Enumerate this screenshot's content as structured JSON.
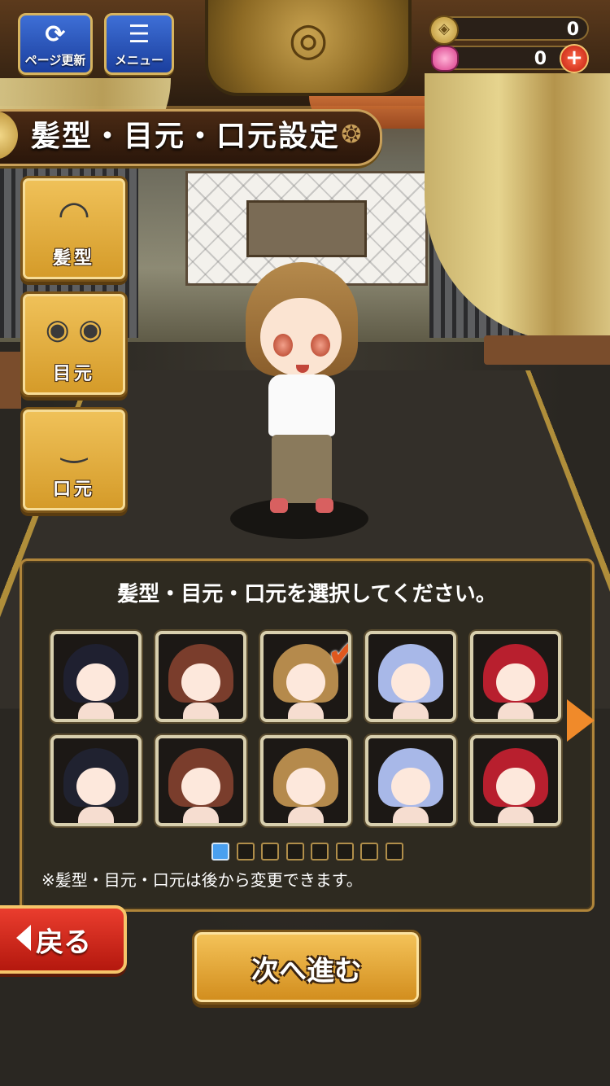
{
  "header": {
    "refresh_label": "ページ更新",
    "menu_label": "メニュー",
    "coin_count": "0",
    "gem_count": "0"
  },
  "title": "髪型・目元・口元設定",
  "categories": [
    {
      "label": "髪型",
      "icon": "hair-icon"
    },
    {
      "label": "目元",
      "icon": "eyes-icon"
    },
    {
      "label": "口元",
      "icon": "mouth-icon"
    }
  ],
  "panel": {
    "instruction": "髪型・目元・口元を選択してください。",
    "options_row1": [
      {
        "color": "#1f2030"
      },
      {
        "color": "#7a3d2c"
      },
      {
        "color": "#b58a4c",
        "selected": true
      },
      {
        "color": "#a8b8e8"
      },
      {
        "color": "#b81f2e"
      }
    ],
    "options_row2": [
      {
        "color": "#202230"
      },
      {
        "color": "#7a3d2c"
      },
      {
        "color": "#b58a4c"
      },
      {
        "color": "#a8b8e8"
      },
      {
        "color": "#b81f2e"
      }
    ],
    "page_count": 8,
    "active_page": 1,
    "note": "※髪型・目元・口元は後から変更できます。"
  },
  "buttons": {
    "back_label": "戻る",
    "next_label": "次へ進む"
  }
}
